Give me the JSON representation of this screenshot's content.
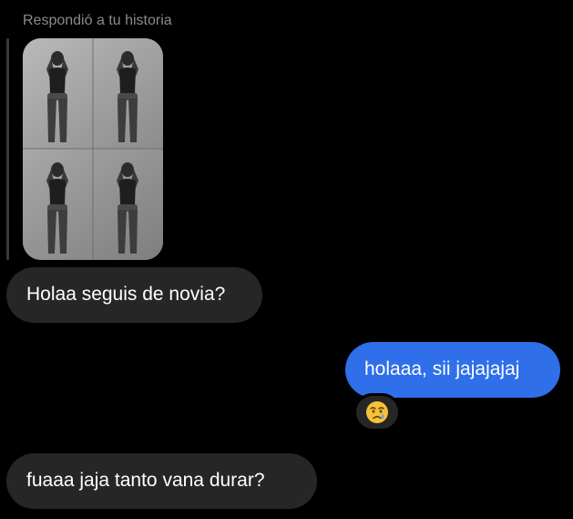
{
  "story_reply": {
    "caption": "Respondió a tu historia",
    "thumbnail_icon": "story-photo-grid"
  },
  "messages": [
    {
      "direction": "received",
      "text": "Holaa seguis de novia?"
    },
    {
      "direction": "sent",
      "text": "holaaa, sii jajajajaj",
      "reaction_icon": "crying-face-emoji"
    },
    {
      "direction": "received",
      "text": "fuaaa jaja tanto vana  durar?"
    }
  ],
  "colors": {
    "background": "#000000",
    "received_bubble": "#262626",
    "sent_bubble": "#2f6fea",
    "caption_text": "#8a8a8a"
  }
}
